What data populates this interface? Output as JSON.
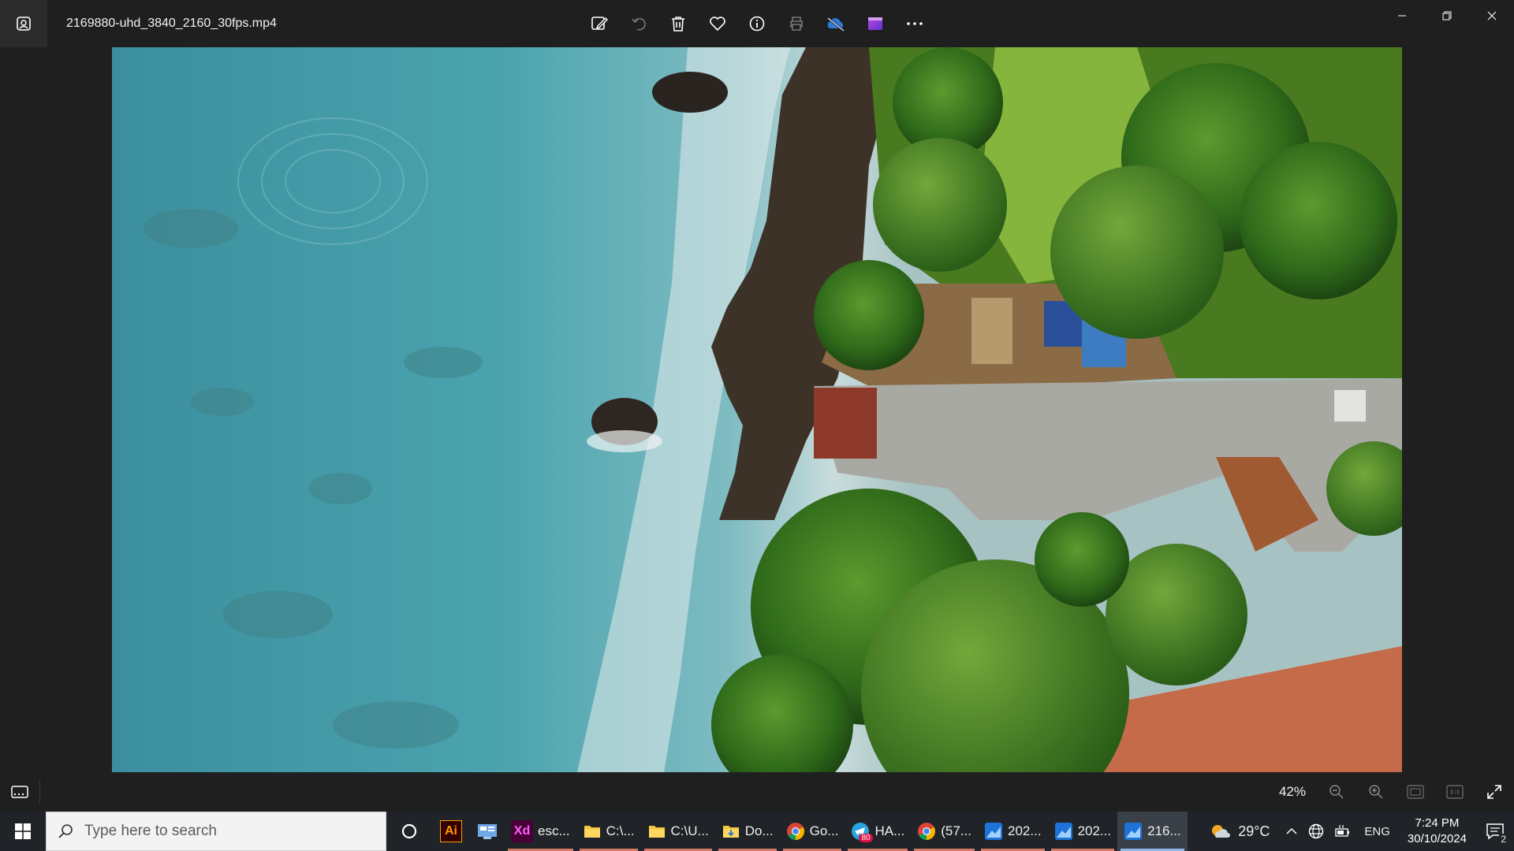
{
  "window": {
    "file_name": "2169880-uhd_3840_2160_30fps.mp4",
    "toolbar": [
      {
        "name": "edit-image-icon",
        "label": "Edit image"
      },
      {
        "name": "rotate-icon",
        "label": "Rotate"
      },
      {
        "name": "delete-icon",
        "label": "Delete"
      },
      {
        "name": "favorite-icon",
        "label": "Favorite"
      },
      {
        "name": "info-icon",
        "label": "File information"
      },
      {
        "name": "print-icon",
        "label": "Print"
      },
      {
        "name": "onedrive-icon",
        "label": "OneDrive"
      },
      {
        "name": "clipchamp-icon",
        "label": "Clipchamp"
      },
      {
        "name": "more-icon",
        "label": "See more"
      }
    ]
  },
  "bottombar": {
    "zoom_label": "42%"
  },
  "taskbar": {
    "search_placeholder": "Type here to search",
    "apps": [
      {
        "label": "",
        "icon": "illustrator-icon",
        "icon_text": "Ai"
      },
      {
        "label": "",
        "icon": "control-panel-icon",
        "icon_text": ""
      },
      {
        "label": "esc...",
        "icon": "adobe-xd-icon",
        "icon_text": "Xd"
      },
      {
        "label": "C:\\...",
        "icon": "folder-icon",
        "icon_text": ""
      },
      {
        "label": "C:\\U...",
        "icon": "folder-icon",
        "icon_text": ""
      },
      {
        "label": "Do...",
        "icon": "folder-download-icon",
        "icon_text": ""
      },
      {
        "label": "Go...",
        "icon": "chrome-icon",
        "icon_text": ""
      },
      {
        "label": "HA...",
        "icon": "telegram-icon",
        "icon_text": "",
        "badge": "80"
      },
      {
        "label": "(57...",
        "icon": "chrome-icon",
        "icon_text": ""
      },
      {
        "label": "202...",
        "icon": "photos-icon",
        "icon_text": ""
      },
      {
        "label": "202...",
        "icon": "photos-icon",
        "icon_text": ""
      },
      {
        "label": "216...",
        "icon": "photos-icon",
        "icon_text": "",
        "active": true
      }
    ],
    "weather": "29°C",
    "language": "ENG",
    "time": "7:24 PM",
    "date": "30/10/2024",
    "notifications": "2"
  },
  "colors": {
    "accent_underline": "#d77a68",
    "active_underline": "#8fb8e8",
    "titlebar_bg": "#1f1f1f",
    "taskbar_bg": "#202428"
  }
}
